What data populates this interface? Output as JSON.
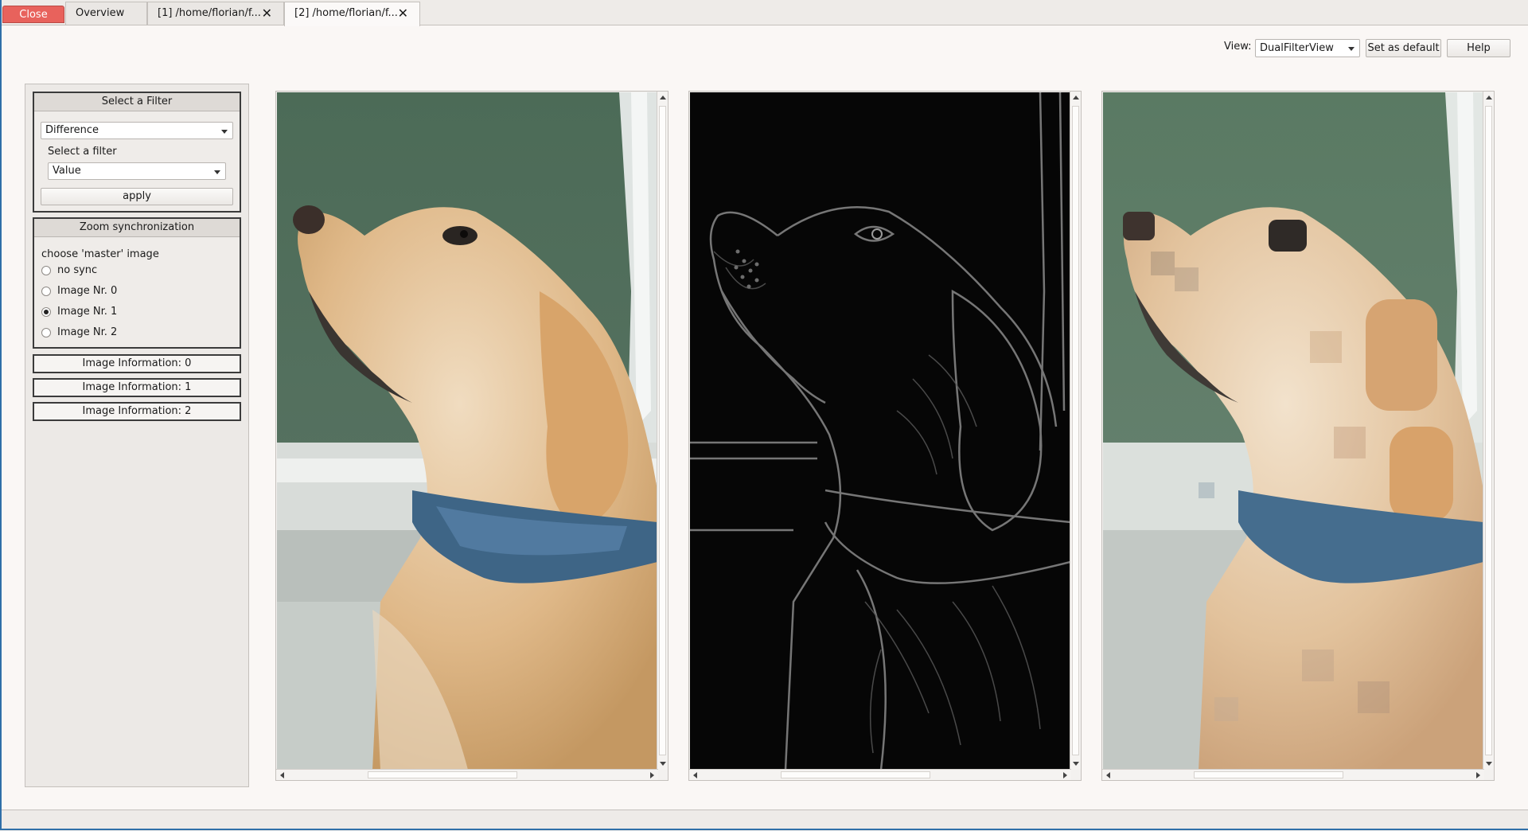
{
  "tabs": {
    "close_label": "Close",
    "items": [
      {
        "label": "Overview"
      },
      {
        "label": "[1] /home/florian/f..."
      },
      {
        "label": "[2] /home/florian/f..."
      }
    ],
    "close_icon": "x-icon"
  },
  "view": {
    "label": "View:",
    "selected": "DualFilterView",
    "set_default_label": "Set as default",
    "help_label": "Help"
  },
  "filter": {
    "title": "Select a Filter",
    "filter_type": "Difference",
    "sub_label": "Select a filter",
    "sub_filter": "Value",
    "apply_label": "apply"
  },
  "zoom": {
    "title": "Zoom synchronization",
    "prompt": "choose 'master' image",
    "options": [
      {
        "label": "no sync",
        "checked": false
      },
      {
        "label": "Image Nr. 0",
        "checked": false
      },
      {
        "label": "Image Nr. 1",
        "checked": true
      },
      {
        "label": "Image Nr. 2",
        "checked": false
      }
    ]
  },
  "info_buttons": [
    {
      "label": "Image Information: 0"
    },
    {
      "label": "Image Information: 1"
    },
    {
      "label": "Image Information: 2"
    }
  ],
  "images": [
    {
      "kind": "original photo of a golden retriever with blue scarf"
    },
    {
      "kind": "edge-detected difference filter result"
    },
    {
      "kind": "blurred / blocky filtered photo"
    }
  ],
  "colors": {
    "close_button": "#e8625c",
    "background": "#faf7f5",
    "group_border": "#3b3b3b"
  }
}
